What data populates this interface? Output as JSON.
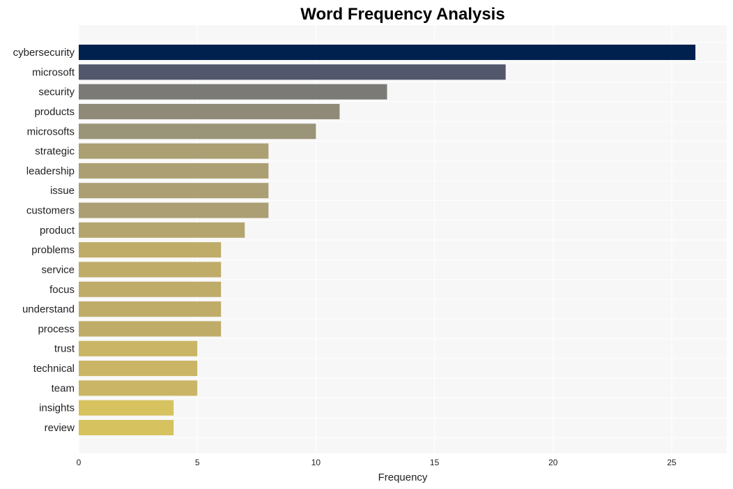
{
  "chart_data": {
    "type": "bar",
    "orientation": "horizontal",
    "title": "Word Frequency Analysis",
    "xlabel": "Frequency",
    "ylabel": "",
    "xlim": [
      0,
      27.3
    ],
    "xticks": [
      0,
      5,
      10,
      15,
      20,
      25
    ],
    "grid": true,
    "legend": "none",
    "categories": [
      "cybersecurity",
      "microsoft",
      "security",
      "products",
      "microsofts",
      "strategic",
      "leadership",
      "issue",
      "customers",
      "product",
      "problems",
      "service",
      "focus",
      "understand",
      "process",
      "trust",
      "technical",
      "team",
      "insights",
      "review"
    ],
    "values": [
      26,
      18,
      13,
      11,
      10,
      8,
      8,
      8,
      8,
      7,
      6,
      6,
      6,
      6,
      6,
      5,
      5,
      5,
      4,
      4
    ],
    "colors": [
      "#00214e",
      "#52576b",
      "#7b7a77",
      "#8e8a77",
      "#9a9478",
      "#ab9f73",
      "#ab9f73",
      "#ab9f73",
      "#ab9f73",
      "#b4a56f",
      "#bfac69",
      "#bfac69",
      "#bfac69",
      "#bfac69",
      "#bfac69",
      "#c9b565",
      "#c9b565",
      "#c9b565",
      "#d6c25f",
      "#d6c25f"
    ],
    "background": "#f7f7f7",
    "gridcolor": "#ffffff"
  }
}
